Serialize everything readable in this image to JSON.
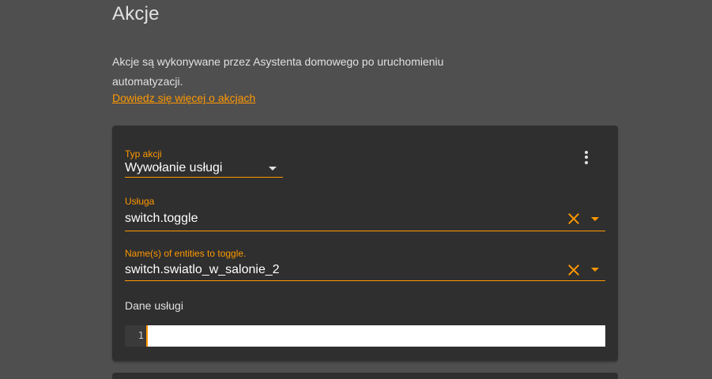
{
  "section": {
    "title": "Akcje",
    "description": "Akcje są wykonywane przez Asystenta domowego po uruchomieniu automatyzacji.",
    "learn_more_link": "Dowiedz się więcej o akcjach"
  },
  "action_card": {
    "action_type": {
      "label": "Typ akcji",
      "value": "Wywołanie usługi"
    },
    "service": {
      "label": "Usługa",
      "value": "switch.toggle"
    },
    "entities": {
      "label": "Name(s) of entities to toggle.",
      "value": "switch.swiatlo_w_salonie_2"
    },
    "service_data": {
      "label": "Dane usługi",
      "line_numbers": [
        "1"
      ],
      "content": ""
    }
  },
  "colors": {
    "accent": "#ff9800",
    "background": "#4f4f4f",
    "card": "#2f2f2f"
  }
}
